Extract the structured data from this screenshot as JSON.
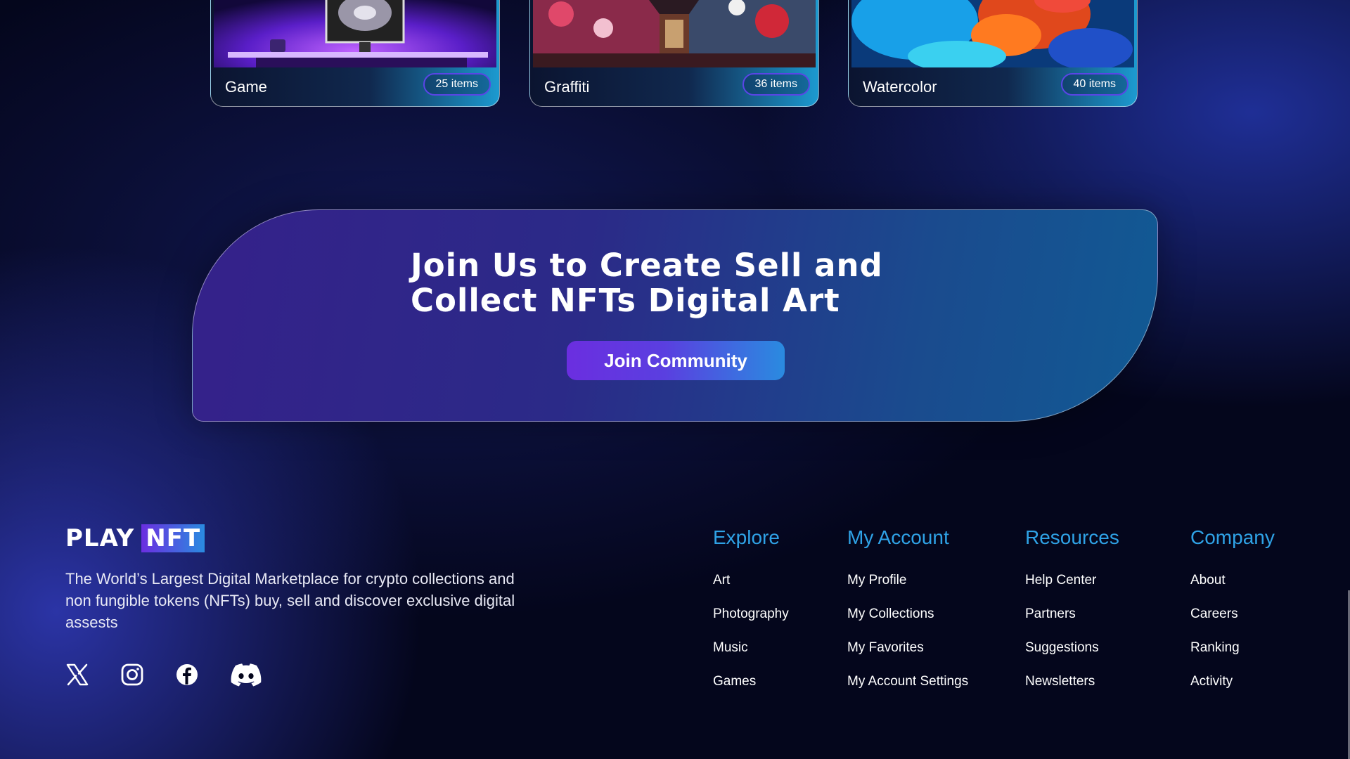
{
  "collections": [
    {
      "name": "Game",
      "count": "25 items"
    },
    {
      "name": "Graffiti",
      "count": "36 items"
    },
    {
      "name": "Watercolor",
      "count": "40 items"
    }
  ],
  "cta": {
    "title_line1": "Join Us to Create Sell and",
    "title_line2": "Collect NFTs Digital Art",
    "button_label": "Join Community"
  },
  "brand": {
    "play": "PLAY",
    "nft": "NFT",
    "tagline": "The World’s Largest Digital Marketplace for crypto collections and non fungible tokens (NFTs) buy, sell and discover exclusive digital assests"
  },
  "social_icons": [
    "x-icon",
    "instagram-icon",
    "facebook-icon",
    "discord-icon"
  ],
  "footer": {
    "explore": {
      "heading": "Explore",
      "links": [
        "Art",
        "Photography",
        "Music",
        "Games"
      ]
    },
    "account": {
      "heading": "My Account",
      "links": [
        "My Profile",
        "My Collections",
        "My Favorites",
        "My Account Settings"
      ]
    },
    "resources": {
      "heading": "Resources",
      "links": [
        "Help Center",
        "Partners",
        "Suggestions",
        "Newsletters"
      ]
    },
    "company": {
      "heading": "Company",
      "links": [
        "About",
        "Careers",
        "Ranking",
        "Activity"
      ]
    }
  },
  "colors": {
    "background": "#04061c",
    "accent_blue": "#2fa2e6",
    "accent_purple": "#6b2ee0",
    "badge_border": "#5a45e6"
  }
}
